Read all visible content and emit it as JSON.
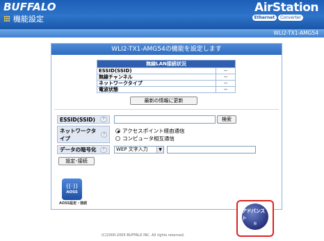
{
  "header": {
    "brand": "BUFFALO",
    "menu_title": "機能設定",
    "product": "AirStation",
    "badge_ethernet": "Ethernet",
    "badge_converter": "Converter",
    "model": "WLI2-TX1-AMG54"
  },
  "panel": {
    "title": "WLI2-TX1-AMG54の機能を設定します",
    "status_table": {
      "header": "無線LAN接続状況",
      "rows": [
        {
          "label": "ESSID(SSID)",
          "value": "--"
        },
        {
          "label": "無線チャンネル",
          "value": "--"
        },
        {
          "label": "ネットワークタイプ",
          "value": "--"
        },
        {
          "label": "電波状態",
          "value": "--"
        }
      ]
    },
    "refresh_button": "最新の情報に更新",
    "form": {
      "ssid_label": "ESSID(SSID)",
      "ssid_value": "",
      "search_button": "検索",
      "network_type_label": "ネットワークタイプ",
      "network_options": [
        {
          "label": "アクセスポイント経由通信",
          "selected": true
        },
        {
          "label": "コンピュータ相互通信",
          "selected": false
        }
      ],
      "encryption_label": "データの暗号化",
      "encryption_select": "WEP 文字入力",
      "encryption_value": "",
      "apply_button": "設定･接続",
      "help_glyph": "?"
    },
    "aoss": {
      "button_text": "AOSS",
      "label": "AOSS設定・接続"
    }
  },
  "advanced": {
    "label": "アドバンスト"
  },
  "footer": {
    "copyright": "(C)2000-2005 BUFFALO INC. All rights reserved."
  },
  "colors": {
    "header_blue": "#1d5fb8",
    "table_header": "#2f5fae",
    "highlight_red": "#e02020"
  },
  "icons": {
    "aoss": "wireless-signal-icon",
    "advanced": "advanced-globe-icon",
    "help": "help-icon",
    "menu": "grid-menu-icon"
  }
}
